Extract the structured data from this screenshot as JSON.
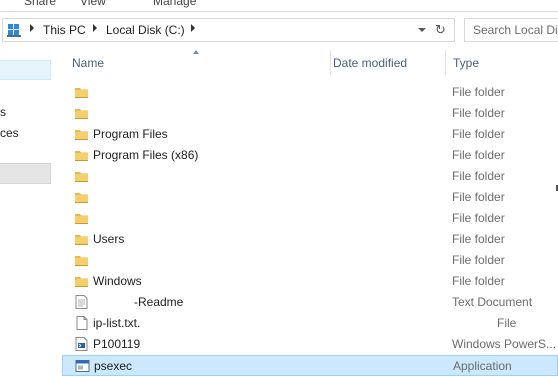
{
  "ribbon": {
    "tabs": [
      "Share",
      "View",
      "Manage"
    ]
  },
  "address": {
    "crumbs": [
      "This PC",
      "Local Disk (C:)"
    ],
    "search_placeholder": "Search Local Di"
  },
  "nav": {
    "items": [
      "s",
      "ces"
    ]
  },
  "columns": {
    "name": "Name",
    "date_modified": "Date modified",
    "type": "Type"
  },
  "files": [
    {
      "name": "",
      "type": "File folder",
      "icon": "folder-icon",
      "selected": false
    },
    {
      "name": "",
      "type": "File folder",
      "icon": "folder-icon",
      "selected": false
    },
    {
      "name": "Program Files",
      "type": "File folder",
      "icon": "folder-icon",
      "selected": false
    },
    {
      "name": "Program Files (x86)",
      "type": "File folder",
      "icon": "folder-icon",
      "selected": false
    },
    {
      "name": "",
      "type": "File folder",
      "icon": "folder-icon",
      "selected": false
    },
    {
      "name": "",
      "type": "File folder",
      "icon": "folder-icon",
      "selected": false
    },
    {
      "name": "",
      "type": "File folder",
      "icon": "folder-icon",
      "selected": false
    },
    {
      "name": "Users",
      "type": "File folder",
      "icon": "folder-icon",
      "selected": false
    },
    {
      "name": "",
      "type": "File folder",
      "icon": "folder-icon",
      "selected": false
    },
    {
      "name": "Windows",
      "type": "File folder",
      "icon": "folder-icon",
      "selected": false
    },
    {
      "name": "-Readme",
      "type": "Text Document",
      "icon": "text-document-icon",
      "selected": false
    },
    {
      "name": "ip-list.txt.",
      "type": "File",
      "icon": "file-icon",
      "selected": false
    },
    {
      "name": "P100119",
      "type": "Windows PowerS...",
      "icon": "powershell-script-icon",
      "selected": false
    },
    {
      "name": "psexec",
      "type": "Application",
      "icon": "application-icon",
      "selected": true
    }
  ],
  "colors": {
    "selection_bg": "#cce8ff",
    "selection_border": "#99d1ff",
    "folder_yellow": "#e8b84a",
    "header_text": "#4c607a"
  }
}
